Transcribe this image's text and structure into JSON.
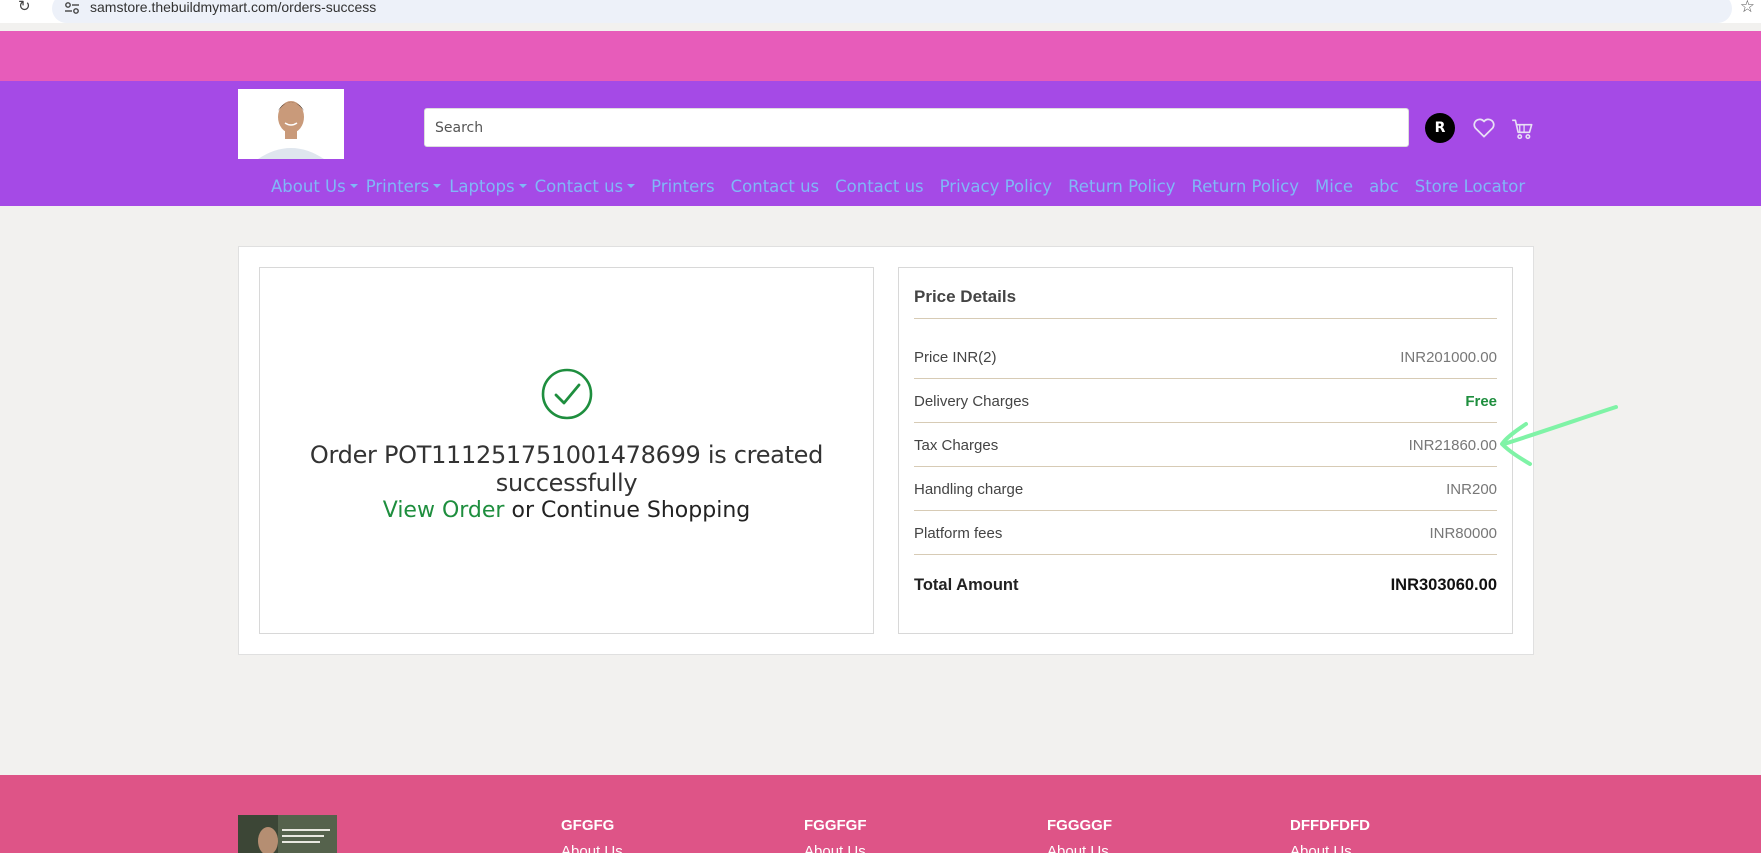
{
  "browser": {
    "url": "samstore.thebuildmymart.com/orders-success"
  },
  "header": {
    "search_placeholder": "Search",
    "avatar_initial": "R",
    "nav": [
      {
        "label": "About Us",
        "dropdown": true
      },
      {
        "label": "Printers",
        "dropdown": true
      },
      {
        "label": "Laptops",
        "dropdown": true
      },
      {
        "label": "Contact us",
        "dropdown": true
      },
      {
        "label": "Printers",
        "dropdown": false
      },
      {
        "label": "Contact us",
        "dropdown": false
      },
      {
        "label": "Contact us",
        "dropdown": false
      },
      {
        "label": "Privacy Policy",
        "dropdown": false
      },
      {
        "label": "Return Policy",
        "dropdown": false
      },
      {
        "label": "Return Policy",
        "dropdown": false
      },
      {
        "label": "Mice",
        "dropdown": false
      },
      {
        "label": "abc",
        "dropdown": false
      },
      {
        "label": "Store Locator",
        "dropdown": false
      }
    ]
  },
  "order": {
    "message": "Order POT111251751001478699 is created successfully",
    "view_order_label": "View Order",
    "or_text": " or ",
    "continue_label": "Continue Shopping"
  },
  "price_details": {
    "title": "Price Details",
    "rows": [
      {
        "label": "Price INR(2)",
        "value": "INR201000.00"
      },
      {
        "label": "Delivery Charges",
        "value": "Free"
      },
      {
        "label": "Tax Charges",
        "value": "INR21860.00"
      },
      {
        "label": "Handling charge",
        "value": "INR200"
      },
      {
        "label": "Platform fees",
        "value": "INR80000"
      }
    ],
    "total_label": "Total Amount",
    "total_value": "INR303060.00"
  },
  "footer": {
    "columns": [
      {
        "title": "GFGFG",
        "link": "About Us"
      },
      {
        "title": "FGGFGF",
        "link": "About Us"
      },
      {
        "title": "FGGGGF",
        "link": "About Us"
      },
      {
        "title": "DFFDFDFD",
        "link": "About Us"
      }
    ]
  },
  "colors": {
    "promo_bar": "#e75cba",
    "header": "#a54ae6",
    "nav_link": "#80b8f7",
    "success_green": "#1e8e3e",
    "footer": "#de5487",
    "annotation_arrow": "#7ff3a6"
  }
}
